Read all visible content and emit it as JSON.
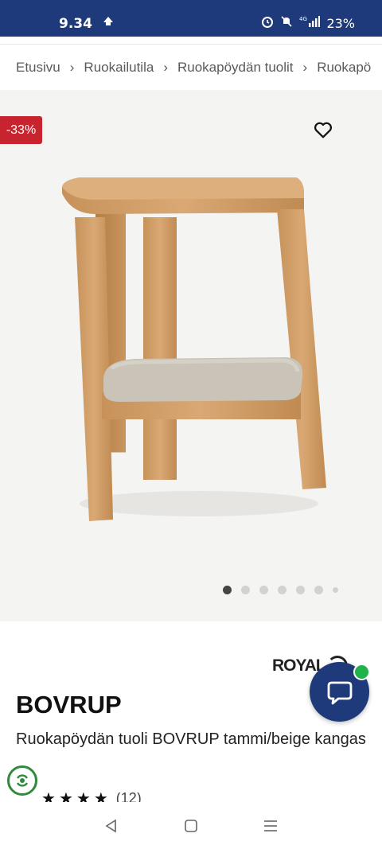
{
  "status_bar": {
    "time": "9.34",
    "battery": "23%",
    "signal_label": "4G"
  },
  "breadcrumb": [
    "Etusivu",
    "Ruokailutila",
    "Ruokapöydän tuolit",
    "Ruokapö"
  ],
  "product_image": {
    "discount_badge": "-33%",
    "gallery_count": 7,
    "active_index": 0
  },
  "product": {
    "brand": "ROYAL",
    "title": "BOVRUP",
    "subtitle": "Ruokapöydän tuoli BOVRUP tammi/beige kangas",
    "rating_count": "(12)"
  },
  "colors": {
    "status_bar": "#1f3a7a",
    "discount": "#c8242f",
    "chat_online": "#21b24b",
    "eco": "#2f8a3a"
  },
  "icons": {
    "favorite": "heart-outline",
    "chat": "speech-bubble",
    "eco": "recycling-leaf",
    "nav_back": "triangle-left",
    "nav_home": "square",
    "nav_menu": "three-lines"
  }
}
